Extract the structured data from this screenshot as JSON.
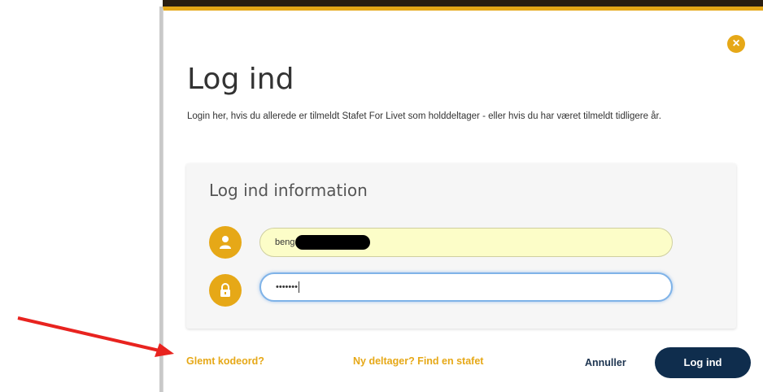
{
  "modal": {
    "title": "Log ind",
    "description": "Login her, hvis du allerede er tilmeldt Stafet For Livet som holddeltager - eller hvis du har været tilmeldt tidligere år.",
    "close_icon": "×",
    "panel": {
      "title": "Log ind information",
      "username": {
        "icon": "user-icon",
        "value": "beng"
      },
      "password": {
        "icon": "lock-icon",
        "value": "•••••••"
      }
    },
    "footer": {
      "forgot_link": "Glemt kodeord?",
      "new_participant_link": "Ny deltager? Find en stafet",
      "cancel_label": "Annuller",
      "login_label": "Log ind"
    }
  },
  "colors": {
    "accent": "#e6a817",
    "primary_button": "#0f2d4d",
    "annotation_arrow": "#e8231f"
  }
}
